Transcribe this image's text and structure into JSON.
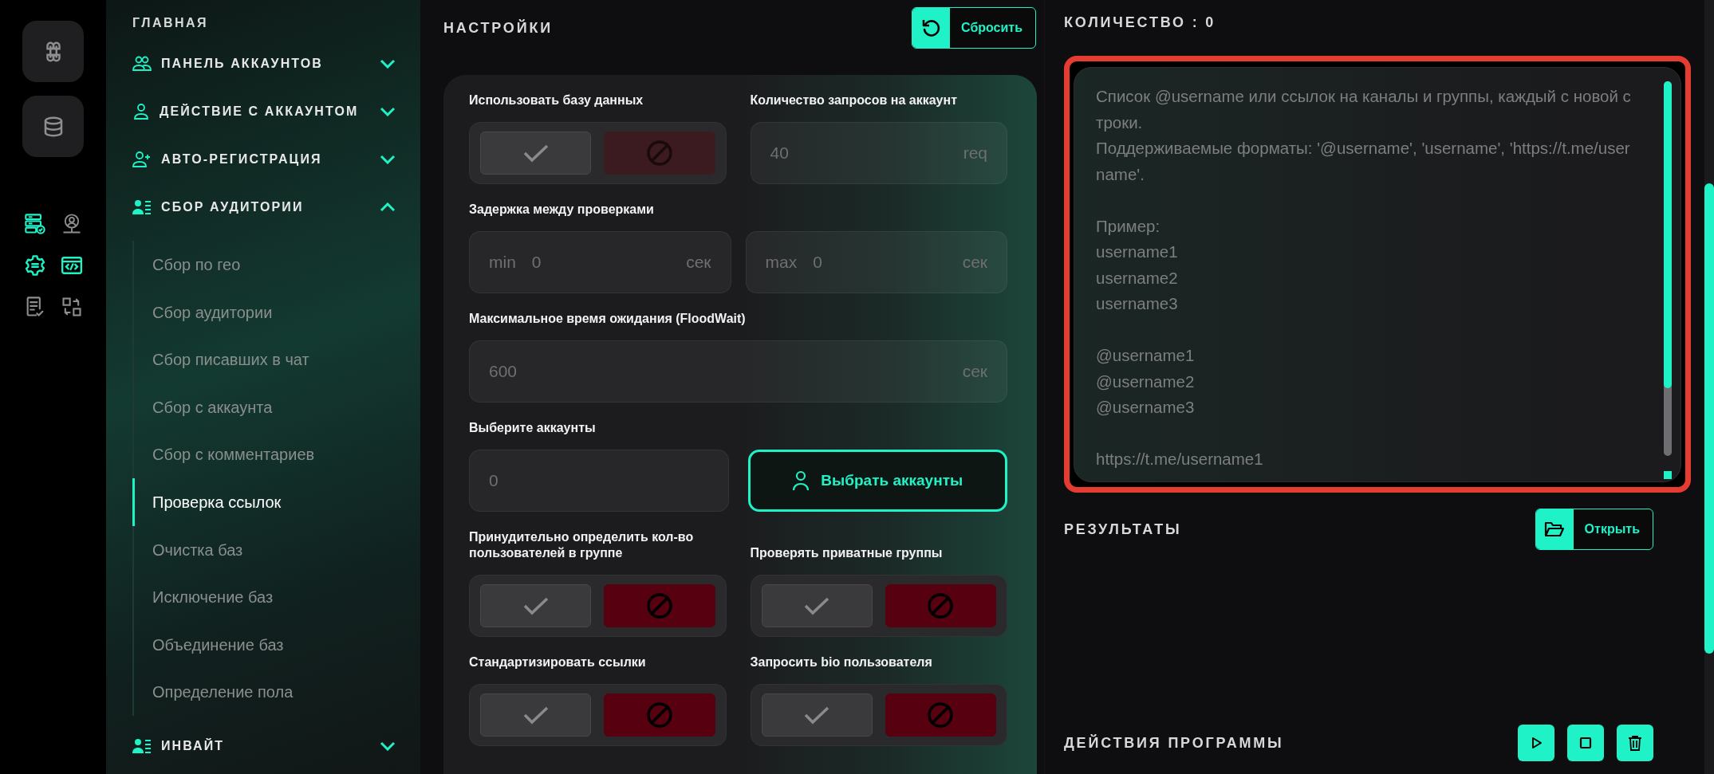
{
  "rail": {
    "buttons": [
      {
        "kind": "command"
      },
      {
        "kind": "database"
      }
    ],
    "tools": [
      {
        "kind": "server",
        "selected": true
      },
      {
        "kind": "network",
        "selected": false
      },
      {
        "kind": "gear",
        "selected": true
      },
      {
        "kind": "code",
        "selected": true
      },
      {
        "kind": "checklist",
        "selected": false
      },
      {
        "kind": "swap",
        "selected": false
      }
    ]
  },
  "sidebar": {
    "home": "ГЛАВНАЯ",
    "sections": [
      {
        "label": "ПАНЕЛЬ АККАУНТОВ",
        "kind": "users",
        "expanded": false
      },
      {
        "label": "ДЕЙСТВИЕ С АККАУНТОМ",
        "kind": "user",
        "expanded": false
      },
      {
        "label": "АВТО-РЕГИСТРАЦИЯ",
        "kind": "user-add",
        "expanded": false
      },
      {
        "label": "СБОР АУДИТОРИИ",
        "kind": "audience",
        "expanded": true,
        "children": [
          {
            "label": "Сбор по гео",
            "selected": false
          },
          {
            "label": "Сбор аудитории",
            "selected": false
          },
          {
            "label": "Сбор писавших в чат",
            "selected": false
          },
          {
            "label": "Сбор с аккаунта",
            "selected": false
          },
          {
            "label": "Сбор с комментариев",
            "selected": false
          },
          {
            "label": "Проверка ссылок",
            "selected": true
          },
          {
            "label": "Очистка баз",
            "selected": false
          },
          {
            "label": "Исключение баз",
            "selected": false
          },
          {
            "label": "Объединение баз",
            "selected": false
          },
          {
            "label": "Определение пола",
            "selected": false
          }
        ]
      },
      {
        "label": "ИНВАЙТ",
        "kind": "audience",
        "expanded": false
      }
    ]
  },
  "settings": {
    "title": "НАСТРОЙКИ",
    "reset": "Сбросить",
    "rows": [
      [
        {
          "kind": "toggle",
          "label": "Использовать базу данных",
          "on": false,
          "disabled": true
        },
        {
          "kind": "number",
          "label": "Количество запросов на аккаунт",
          "value": "40",
          "unit": "req"
        }
      ],
      [
        {
          "kind": "range",
          "label": "Задержка между проверками",
          "min": {
            "prefix": "min",
            "value": "0",
            "unit": "сек"
          },
          "max": {
            "prefix": "max",
            "value": "0",
            "unit": "сек"
          }
        }
      ],
      [
        {
          "kind": "number",
          "label": "Максимальное время ожидания (FloodWait)",
          "value": "600",
          "unit": "сек"
        }
      ],
      [
        {
          "kind": "picker",
          "label": "Выберите аккаунты",
          "value": "0",
          "button": "Выбрать аккаунты"
        }
      ],
      [
        {
          "kind": "toggle",
          "label": "Принудительно определить кол-во пользователей в группе",
          "on": false,
          "disabled": false
        },
        {
          "kind": "toggle",
          "label": "Проверять приватные группы",
          "on": false,
          "disabled": false
        }
      ],
      [
        {
          "kind": "toggle",
          "label": "Стандартизировать ссылки",
          "on": false,
          "disabled": false
        },
        {
          "kind": "toggle",
          "label": "Запросить bio пользователя",
          "on": false,
          "disabled": false
        }
      ]
    ]
  },
  "right": {
    "count": "КОЛИЧЕСТВО : 0",
    "input": {
      "highlighted": true,
      "placeholder": "Список @username или ссылок на каналы и группы, каждый с новой строки.\nПоддерживаемые форматы: '@username', 'username', 'https://t.me/username'.\n\nПример:\nusername1\nusername2\nusername3\n\n@username1\n@username2\n@username3\n\nhttps://t.me/username1"
    },
    "results": {
      "title": "РЕЗУЛЬТАТЫ",
      "button": "Открыть"
    },
    "actions": {
      "title": "ДЕЙСТВИЯ ПРОГРАММЫ",
      "buttons": [
        {
          "kind": "play"
        },
        {
          "kind": "stop"
        },
        {
          "kind": "delete"
        }
      ]
    }
  }
}
